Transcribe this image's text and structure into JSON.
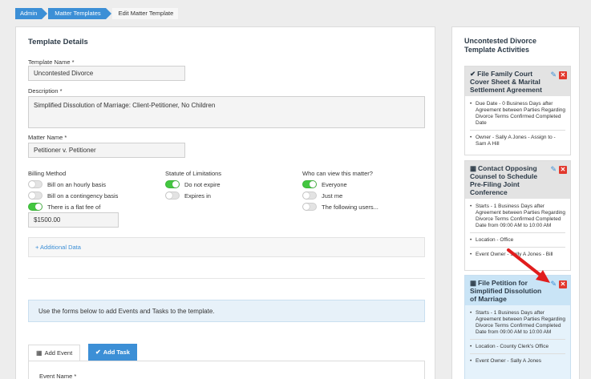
{
  "breadcrumb": [
    "Admin",
    "Matter Templates",
    "Edit Matter Template"
  ],
  "template": {
    "section_title": "Template Details",
    "name_label": "Template Name *",
    "name_value": "Uncontested Divorce",
    "description_label": "Description *",
    "description_value": "Simplified Dissolution of Marriage:  Client-Petitioner, No Children",
    "matter_label": "Matter Name *",
    "matter_value": "Petitioner v. Petitioner"
  },
  "billing": {
    "label": "Billing Method",
    "options": [
      {
        "label": "Bill on an hourly basis",
        "on": false
      },
      {
        "label": "Bill on a contingency basis",
        "on": false
      },
      {
        "label": "There is a flat fee of",
        "on": true
      }
    ],
    "fee_value": "$1500.00"
  },
  "statute": {
    "label": "Statute of Limitations",
    "options": [
      {
        "label": "Do not expire",
        "on": true
      },
      {
        "label": "Expires in",
        "on": false
      }
    ]
  },
  "visibility": {
    "label": "Who can view this matter?",
    "options": [
      {
        "label": "Everyone",
        "on": true
      },
      {
        "label": "Just me",
        "on": false
      },
      {
        "label": "The following users...",
        "on": false
      }
    ]
  },
  "additional_data": "+ Additional Data",
  "info_text": "Use the forms below to add Events and Tasks to the template.",
  "tabs": {
    "add_event": "Add Event",
    "add_task": "Add Task"
  },
  "event_name_label": "Event Name *",
  "activities": {
    "title": "Uncontested Divorce Template Activities",
    "cards": [
      {
        "title": "File Family Court Cover Sheet & Marital Settlement Agreement",
        "icon": "check-icon",
        "details": [
          "Due Date - 0 Business Days after Agreement between Parties Regarding Divorce Terms Confirmed Completed Date",
          "Owner - Sally A Jones - Assign to - Sam A Hill"
        ]
      },
      {
        "title": "Contact Opposing Counsel to Schedule Pre-Filing Joint Conference",
        "icon": "calendar-icon",
        "details": [
          "Starts - 1 Business Days after Agreement between Parties Regarding Divorce Terms Confirmed Completed Date from 09:00 AM to 10:00 AM",
          "Location - Office",
          "Event Owner - Sally A Jones - Bill"
        ]
      },
      {
        "title": "File Petition for Simplified Dissolution of Marriage",
        "icon": "calendar-icon",
        "details": [
          "Starts - 1 Business Days after Agreement between Parties Regarding Divorce Terms Confirmed Completed Date from 09:00 AM to 10:00 AM",
          "Location - County Clerk's Office",
          "Event Owner - Sally A Jones"
        ]
      }
    ]
  },
  "colors": {
    "accent": "#3c8fd6",
    "toggle_on": "#43c740",
    "delete": "#e2382d",
    "arrow": "#e11d1d"
  }
}
